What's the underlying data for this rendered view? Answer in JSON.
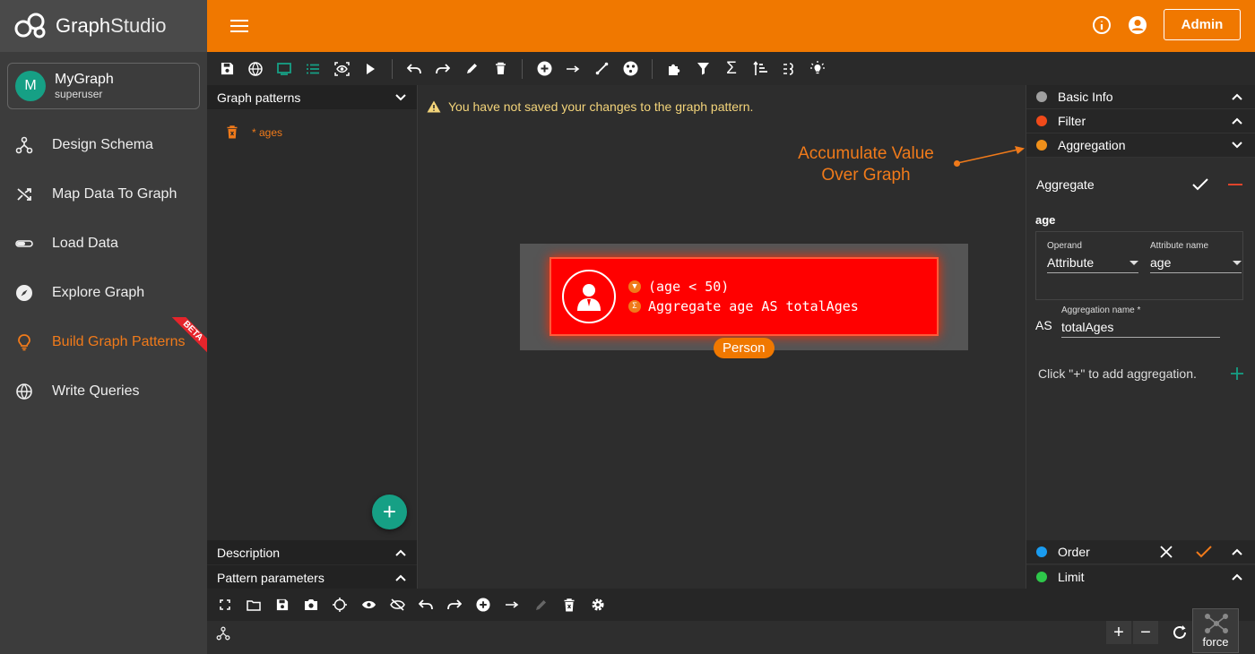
{
  "app": {
    "logo_text_1": "Graph",
    "logo_text_2": "Studio",
    "admin_label": "Admin"
  },
  "graph": {
    "initial": "M",
    "name": "MyGraph",
    "role": "superuser"
  },
  "nav": [
    {
      "label": "Design Schema"
    },
    {
      "label": "Map Data To Graph"
    },
    {
      "label": "Load Data"
    },
    {
      "label": "Explore Graph"
    },
    {
      "label": "Build Graph Patterns",
      "badge": "BETA"
    },
    {
      "label": "Write Queries"
    }
  ],
  "left_panel": {
    "title": "Graph patterns",
    "pattern_item": "* ages",
    "description": "Description",
    "parameters": "Pattern parameters"
  },
  "canvas": {
    "warning": "You have not saved your changes to the graph pattern.",
    "annotation_line1": "Accumulate Value",
    "annotation_line2": "Over Graph",
    "node_filter": "(age < 50)",
    "node_aggregate": "Aggregate age AS totalAges",
    "node_label": "Person"
  },
  "right_panel": {
    "basic_info": "Basic Info",
    "filter": "Filter",
    "aggregation": "Aggregation",
    "aggregate_label": "Aggregate",
    "attr_label": "age",
    "operand_label": "Operand",
    "operand_value": "Attribute",
    "attribute_name_label": "Attribute name",
    "attribute_name_value": "age",
    "as_label": "AS",
    "aggregation_name_label": "Aggregation name *",
    "aggregation_name_value": "totalAges",
    "click_hint": "Click \"+\" to add aggregation.",
    "order": "Order",
    "limit": "Limit"
  },
  "bottom": {
    "force_label": "force"
  },
  "colors": {
    "accent": "#f07800",
    "teal": "#16a085",
    "node": "#ff0000",
    "basic_dot": "#a0a0a0",
    "filter_dot": "#f04a1a",
    "aggregation_dot": "#f0901a",
    "order_dot": "#1a9cf0",
    "limit_dot": "#2ec74a"
  }
}
